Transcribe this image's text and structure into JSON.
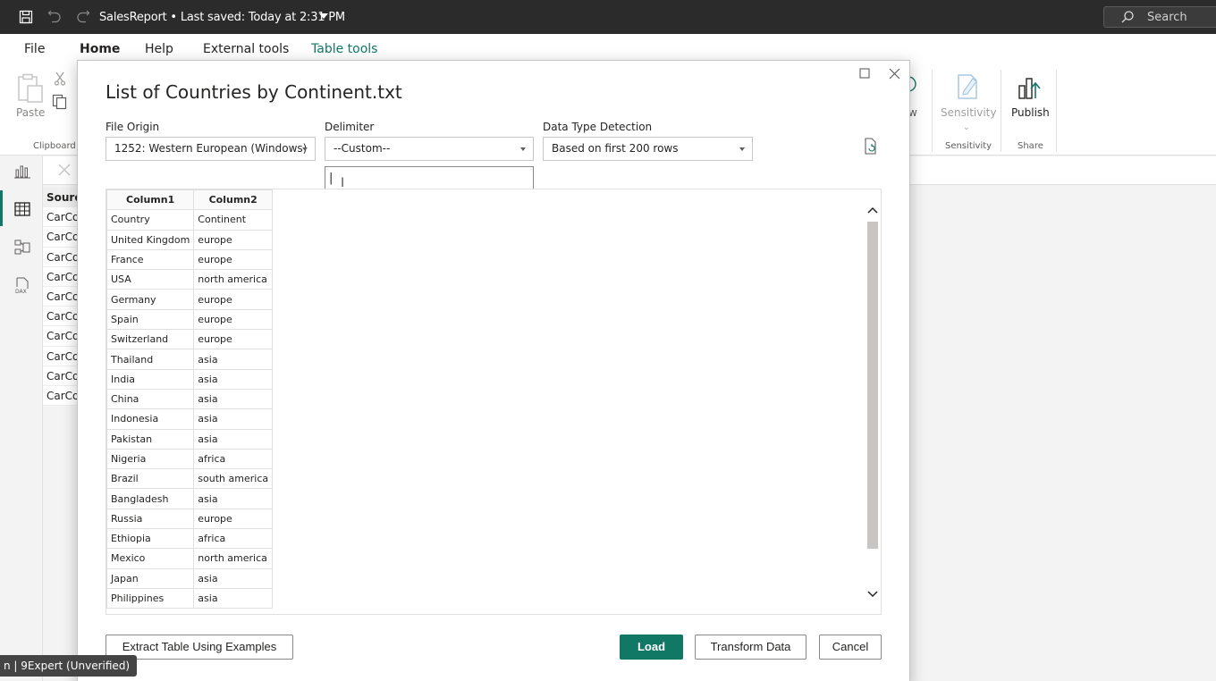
{
  "titlebar": {
    "title": "SalesReport • Last saved: Today at 2:31 PM",
    "search_label": "Search"
  },
  "menu": {
    "items": [
      "File",
      "Home",
      "Help",
      "External tools",
      "Table tools"
    ]
  },
  "ribbon": {
    "paste_label": "Paste",
    "clipboard_group": "Clipboard",
    "sensitivity_label": "Sensitivity",
    "sensitivity_group": "Sensitivity",
    "publish_label": "Publish",
    "share_group": "Share",
    "partial_label": "w"
  },
  "background_table": {
    "header": "Sourc",
    "rows": [
      "CarCo",
      "CarCo",
      "CarCo",
      "CarCo",
      "CarCo",
      "CarCo",
      "CarCo",
      "CarCo",
      "CarCo",
      "CarCo"
    ]
  },
  "watermark": "n | 9Expert (Unverified)",
  "dialog": {
    "title": "List of Countries by Continent.txt",
    "file_origin": {
      "label": "File Origin",
      "value": "1252: Western European (Windows)"
    },
    "delimiter": {
      "label": "Delimiter",
      "value": "--Custom--",
      "custom_value": "|"
    },
    "data_type_detection": {
      "label": "Data Type Detection",
      "value": "Based on first 200 rows"
    },
    "preview": {
      "columns": [
        "Column1",
        "Column2"
      ],
      "rows": [
        [
          "Country",
          "Continent"
        ],
        [
          "United Kingdom",
          "europe"
        ],
        [
          "France",
          "europe"
        ],
        [
          "USA",
          "north america"
        ],
        [
          "Germany",
          "europe"
        ],
        [
          "Spain",
          "europe"
        ],
        [
          "Switzerland",
          "europe"
        ],
        [
          "Thailand",
          "asia"
        ],
        [
          "India",
          "asia"
        ],
        [
          "China",
          "asia"
        ],
        [
          "Indonesia",
          "asia"
        ],
        [
          "Pakistan",
          "asia"
        ],
        [
          "Nigeria",
          "africa"
        ],
        [
          "Brazil",
          "south america"
        ],
        [
          "Bangladesh",
          "asia"
        ],
        [
          "Russia",
          "europe"
        ],
        [
          "Ethiopia",
          "africa"
        ],
        [
          "Mexico",
          "north america"
        ],
        [
          "Japan",
          "asia"
        ],
        [
          "Philippines",
          "asia"
        ]
      ]
    },
    "buttons": {
      "extract": "Extract Table Using Examples",
      "load": "Load",
      "transform": "Transform Data",
      "cancel": "Cancel"
    }
  },
  "colors": {
    "accent": "#117865",
    "titlebar": "#2b2b2b"
  }
}
